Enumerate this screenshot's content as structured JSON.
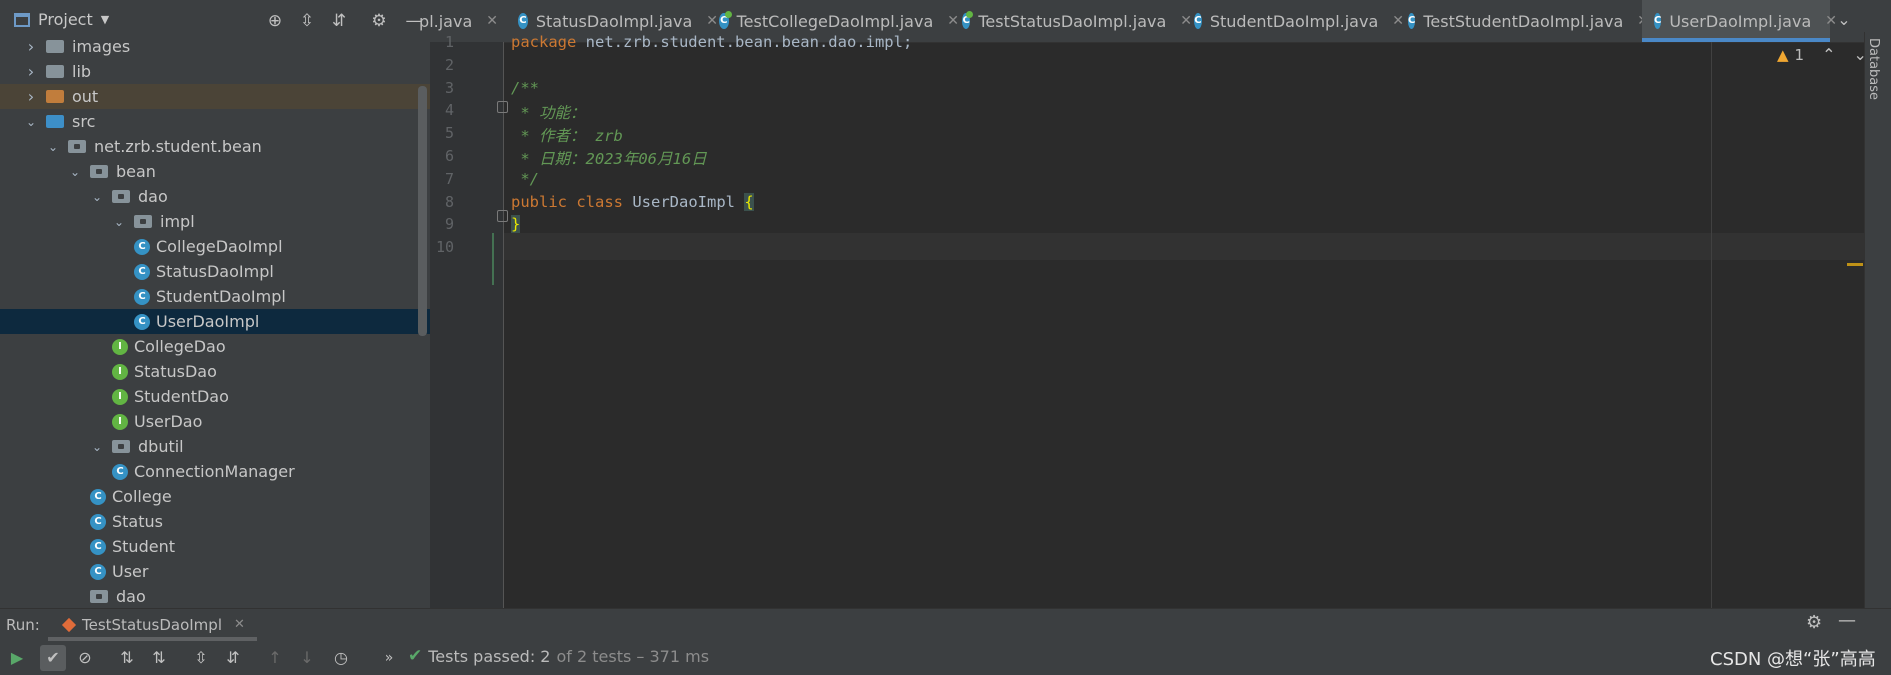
{
  "project_panel": {
    "title": "Project",
    "tree": [
      {
        "label": "images",
        "icon": "folder-icon",
        "kind": "folder",
        "expanded": false,
        "depth": 0
      },
      {
        "label": "lib",
        "icon": "folder-icon",
        "kind": "folder",
        "expanded": false,
        "depth": 0
      },
      {
        "label": "out",
        "icon": "folder-excluded-icon",
        "kind": "folder-orange",
        "expanded": false,
        "depth": 0
      },
      {
        "label": "src",
        "icon": "source-folder-icon",
        "kind": "folder-blue",
        "expanded": true,
        "depth": 0
      },
      {
        "label": "net.zrb.student.bean",
        "icon": "package-icon",
        "kind": "package",
        "expanded": true,
        "depth": 1
      },
      {
        "label": "bean",
        "icon": "package-icon",
        "kind": "package",
        "expanded": true,
        "depth": 2
      },
      {
        "label": "dao",
        "icon": "package-icon",
        "kind": "package",
        "expanded": true,
        "depth": 3
      },
      {
        "label": "impl",
        "icon": "package-icon",
        "kind": "package",
        "expanded": true,
        "depth": 4
      },
      {
        "label": "CollegeDaoImpl",
        "icon": "class-icon",
        "kind": "class",
        "depth": 5
      },
      {
        "label": "StatusDaoImpl",
        "icon": "class-icon",
        "kind": "class",
        "depth": 5
      },
      {
        "label": "StudentDaoImpl",
        "icon": "class-icon",
        "kind": "class",
        "depth": 5
      },
      {
        "label": "UserDaoImpl",
        "icon": "class-icon",
        "kind": "class",
        "depth": 5,
        "selected": true
      },
      {
        "label": "CollegeDao",
        "icon": "interface-icon",
        "kind": "interface",
        "depth": 4
      },
      {
        "label": "StatusDao",
        "icon": "interface-icon",
        "kind": "interface",
        "depth": 4
      },
      {
        "label": "StudentDao",
        "icon": "interface-icon",
        "kind": "interface",
        "depth": 4
      },
      {
        "label": "UserDao",
        "icon": "interface-icon",
        "kind": "interface",
        "depth": 4
      },
      {
        "label": "dbutil",
        "icon": "package-icon",
        "kind": "package",
        "expanded": true,
        "depth": 3
      },
      {
        "label": "ConnectionManager",
        "icon": "class-icon",
        "kind": "class",
        "depth": 4
      },
      {
        "label": "College",
        "icon": "class-icon",
        "kind": "class",
        "depth": 3
      },
      {
        "label": "Status",
        "icon": "class-icon",
        "kind": "class",
        "depth": 3
      },
      {
        "label": "Student",
        "icon": "class-icon",
        "kind": "class",
        "depth": 3
      },
      {
        "label": "User",
        "icon": "class-icon",
        "kind": "class",
        "depth": 3
      },
      {
        "label": "dao",
        "icon": "package-icon",
        "kind": "package",
        "depth": 2,
        "noarrow": true
      }
    ]
  },
  "tabs": [
    {
      "label": "pl.java",
      "icon": "none",
      "test": false,
      "active": false
    },
    {
      "label": "StatusDaoImpl.java",
      "test": false,
      "active": false
    },
    {
      "label": "TestCollegeDaoImpl.java",
      "test": true,
      "active": false
    },
    {
      "label": "TestStatusDaoImpl.java",
      "test": true,
      "active": false
    },
    {
      "label": "StudentDaoImpl.java",
      "test": false,
      "active": false
    },
    {
      "label": "TestStudentDaoImpl.java",
      "test": false,
      "active": false
    },
    {
      "label": "UserDaoImpl.java",
      "test": false,
      "active": true
    }
  ],
  "right_stripe": {
    "database_label": "Database"
  },
  "editor": {
    "warning_count": "1",
    "line_numbers": [
      "1",
      "2",
      "3",
      "4",
      "5",
      "6",
      "7",
      "8",
      "9",
      "10"
    ],
    "lines": [
      [
        {
          "t": "package",
          "c": "kw"
        },
        {
          "t": " net.zrb.student.bean.bean.dao.impl;",
          "c": "plain"
        }
      ],
      [],
      [
        {
          "t": "/**",
          "c": "cmt"
        }
      ],
      [
        {
          "t": " * 功能：",
          "c": "cmt"
        }
      ],
      [
        {
          "t": " * 作者： zrb",
          "c": "cmt"
        }
      ],
      [
        {
          "t": " * 日期：2023年06月16日",
          "c": "cmt"
        }
      ],
      [
        {
          "t": " */",
          "c": "cmt"
        }
      ],
      [
        {
          "t": "public",
          "c": "kw"
        },
        {
          "t": " ",
          "c": "plain"
        },
        {
          "t": "class",
          "c": "kw"
        },
        {
          "t": " UserDaoImpl ",
          "c": "cls-name"
        },
        {
          "t": "{",
          "c": "brace"
        }
      ],
      [
        {
          "t": "}",
          "c": "brace"
        }
      ],
      []
    ]
  },
  "run_panel": {
    "label": "Run:",
    "tab_label": "TestStatusDaoImpl",
    "status_main": "Tests passed: 2",
    "status_sub": "of 2 tests – 371 ms"
  },
  "watermark": "CSDN @想“张”高高",
  "colors": {
    "accent": "#4a88c7",
    "success": "#59a869",
    "warning": "#f0a732"
  }
}
